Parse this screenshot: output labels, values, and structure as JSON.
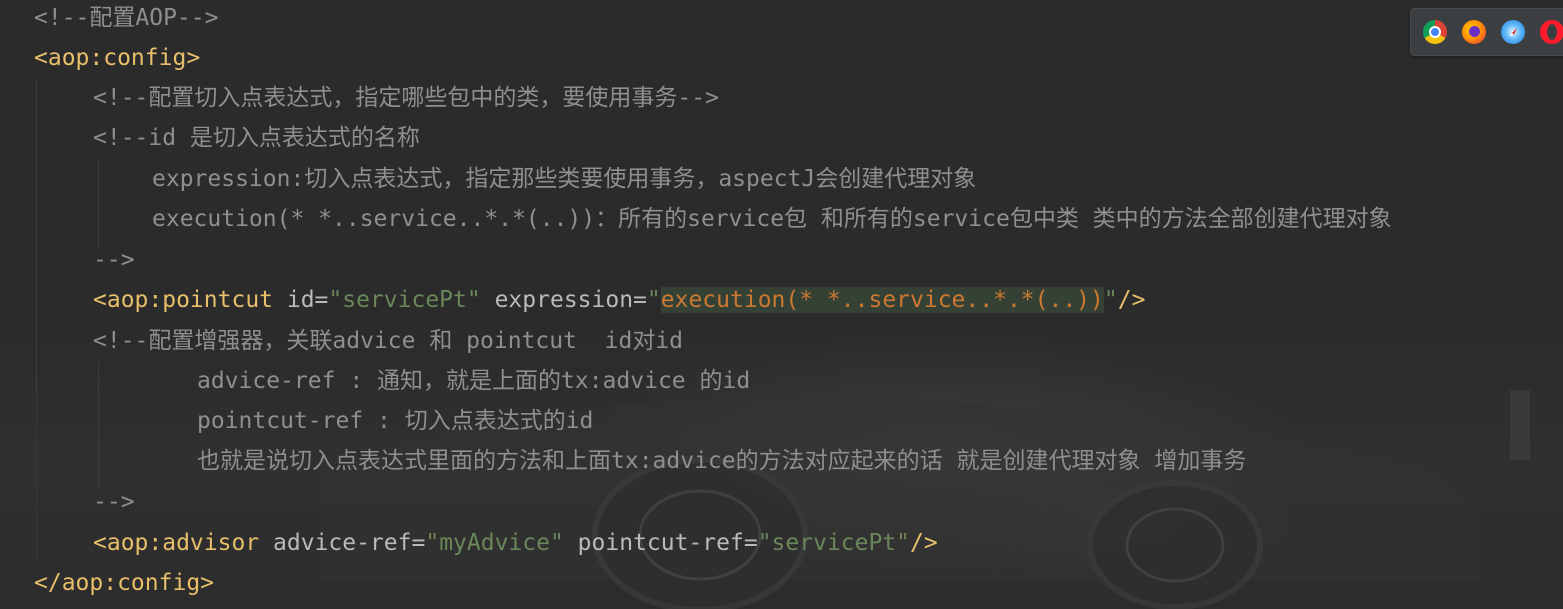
{
  "editor": {
    "lines": [
      {
        "segments": [
          {
            "c": "comment",
            "t": "<!--配置AOP-->"
          }
        ]
      },
      {
        "segments": [
          {
            "c": "tag",
            "t": "<aop:config>"
          }
        ]
      },
      {
        "segments": [
          {
            "c": "comment",
            "t": "<!--配置切入点表达式，指定哪些包中的类，要使用事务-->"
          }
        ]
      },
      {
        "segments": [
          {
            "c": "comment",
            "t": "<!--id 是切入点表达式的名称"
          }
        ]
      },
      {
        "segments": [
          {
            "c": "comment",
            "t": "expression:切入点表达式，指定那些类要使用事务，aspectJ会创建代理对象"
          }
        ]
      },
      {
        "segments": [
          {
            "c": "comment",
            "t": "execution(* *..service..*.*(..))：所有的service包 和所有的service包中类 类中的方法全部创建代理对象"
          }
        ]
      },
      {
        "segments": [
          {
            "c": "comment",
            "t": "-->"
          }
        ]
      },
      {
        "segments": [
          {
            "c": "tag",
            "t": "<aop:pointcut"
          },
          {
            "c": "attr",
            "t": " id="
          },
          {
            "c": "val",
            "t": "\"servicePt\""
          },
          {
            "c": "attr",
            "t": " expression="
          },
          {
            "c": "val",
            "t": "\""
          },
          {
            "c": "hl-exec",
            "t": "execution(* *..service..*.*(..))"
          },
          {
            "c": "val",
            "t": "\""
          },
          {
            "c": "tag",
            "t": "/>"
          }
        ]
      },
      {
        "segments": [
          {
            "c": "comment",
            "t": "<!--配置增强器，关联advice 和 pointcut  id对id"
          }
        ]
      },
      {
        "segments": [
          {
            "c": "comment",
            "t": "advice-ref : 通知，就是上面的tx:advice 的id"
          }
        ]
      },
      {
        "segments": [
          {
            "c": "comment",
            "t": "pointcut-ref : 切入点表达式的id"
          }
        ]
      },
      {
        "segments": [
          {
            "c": "comment",
            "t": "也就是说切入点表达式里面的方法和上面tx:advice的方法对应起来的话 就是创建代理对象 增加事务"
          }
        ]
      },
      {
        "segments": [
          {
            "c": "comment",
            "t": "-->"
          }
        ]
      },
      {
        "segments": [
          {
            "c": "tag",
            "t": "<aop:advisor"
          },
          {
            "c": "attr",
            "t": " advice-ref="
          },
          {
            "c": "val",
            "t": "\"myAdvice\""
          },
          {
            "c": "attr",
            "t": " pointcut-ref="
          },
          {
            "c": "val",
            "t": "\"servicePt\""
          },
          {
            "c": "tag",
            "t": "/>"
          }
        ]
      },
      {
        "segments": [
          {
            "c": "tag",
            "t": "</aop:config>"
          }
        ]
      }
    ]
  },
  "browser_toolbar": {
    "icons": [
      "chrome-icon",
      "firefox-icon",
      "safari-icon",
      "opera-icon"
    ]
  },
  "colors": {
    "background": "#2b2b2b",
    "comment": "#8f8f8f",
    "tag": "#e8bf6a",
    "attribute": "#bababa",
    "value": "#6a8759",
    "highlight": "#344134"
  }
}
